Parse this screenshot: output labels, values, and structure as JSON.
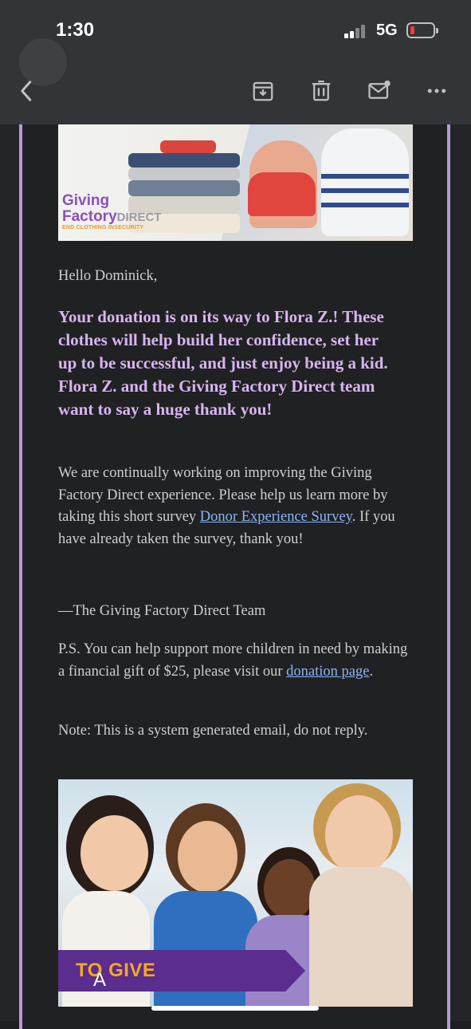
{
  "status_bar": {
    "time": "1:30",
    "network": "5G",
    "signal_bars_filled": 2,
    "battery_level": 0.1
  },
  "toolbar": {
    "back_icon": "chevron-left-icon",
    "archive_icon": "archive-icon",
    "delete_icon": "trash-icon",
    "mark_unread_icon": "mail-unread-icon",
    "more_icon": "more-horizontal-icon"
  },
  "email": {
    "hero_logo": {
      "line1": "Giving",
      "line2": "Factory",
      "line2_suffix": "DIRECT",
      "tagline": "END CLOTHING INSECURITY"
    },
    "greeting": "Hello Dominick,",
    "lead": "Your donation is on its way to Flora Z.! These clothes will help build her confidence, set her up to be successful, and just enjoy being a kid. Flora Z. and the Giving Factory Direct team want to say a huge thank you!",
    "survey_para_before": "We are continually working on improving the Giving Factory Direct experience. Please help us learn more by taking this short survey ",
    "survey_link": "Donor Experience Survey",
    "survey_para_after": ". If you have already taken the survey, thank you!",
    "signature": "—The Giving Factory Direct Team",
    "ps_before": "P.S. You can help support more children in need by making a financial gift of $25, please visit our ",
    "ps_link": "donation page",
    "ps_after": ".",
    "note": "Note: This is a system generated email, do not reply.",
    "banner_white": "A NEW WAY ",
    "banner_orange": "TO GIVE"
  },
  "colors": {
    "accent_purple": "#b79ad8",
    "lead_text": "#d8b4f0",
    "link": "#8ab4f8",
    "banner_bg": "#5a2d8f",
    "banner_highlight": "#f7a823"
  }
}
